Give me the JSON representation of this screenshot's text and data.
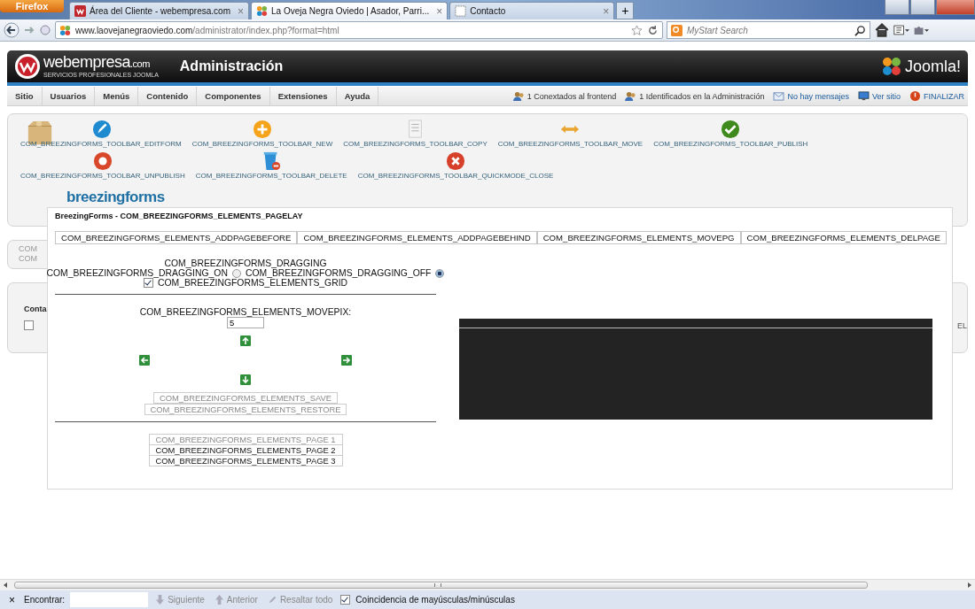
{
  "browser": {
    "app_button": "Firefox",
    "tabs": [
      {
        "title": "Área del Cliente - webempresa.com",
        "close": "×",
        "selected": false
      },
      {
        "title": "La Oveja Negra Oviedo | Asador, Parri...",
        "close": "×",
        "selected": true
      },
      {
        "title": "Contacto",
        "close": "×",
        "selected": false
      }
    ],
    "new_tab": "+",
    "url_host": "www.laovejanegraoviedo.com",
    "url_path": "/administrator/index.php?format=html",
    "search_placeholder": "MyStart Search"
  },
  "header": {
    "brand": "webempresa",
    "brand_suffix": ".com",
    "brand_tagline": "SERVICIOS PROFESIONALES JOOMLA",
    "title": "Administración",
    "cms_logo": "Joomla!"
  },
  "menu": [
    "Sitio",
    "Usuarios",
    "Menús",
    "Contenido",
    "Componentes",
    "Extensiones",
    "Ayuda"
  ],
  "status": [
    {
      "kind": "users",
      "text": "1 Conextados al frontend"
    },
    {
      "kind": "users",
      "text": "1 Identificados en la Administración"
    },
    {
      "kind": "mail",
      "text": "No hay mensajes"
    },
    {
      "kind": "view",
      "text": "Ver sitio"
    },
    {
      "kind": "logout",
      "text": "FINALIZAR"
    }
  ],
  "toolbar": [
    [
      "COM_BREEZINGFORMS_TOOLBAR_EDITFORM",
      "COM_BREEZINGFORMS_TOOLBAR_NEW",
      "COM_BREEZINGFORMS_TOOLBAR_COPY",
      "COM_BREEZINGFORMS_TOOLBAR_MOVE",
      "COM_BREEZINGFORMS_TOOLBAR_PUBLISH"
    ],
    [
      "COM_BREEZINGFORMS_TOOLBAR_UNPUBLISH",
      "COM_BREEZINGFORMS_TOOLBAR_DELETE",
      "COM_BREEZINGFORMS_TOOLBAR_QUICKMODE_CLOSE"
    ]
  ],
  "background": {
    "logo": "breezingforms",
    "stubs": [
      "COM",
      "COM"
    ],
    "section": "Conta",
    "right_stub": "EL",
    "row_checked": false
  },
  "modal": {
    "title": "BreezingForms - COM_BREEZINGFORMS_ELEMENTS_PAGELAY",
    "page_buttons": [
      "COM_BREEZINGFORMS_ELEMENTS_ADDPAGEBEFORE",
      "COM_BREEZINGFORMS_ELEMENTS_ADDPAGEBEHIND",
      "COM_BREEZINGFORMS_ELEMENTS_MOVEPG",
      "COM_BREEZINGFORMS_ELEMENTS_DELPAGE"
    ],
    "dragging_label": "COM_BREEZINGFORMS_DRAGGING",
    "drag_options": [
      {
        "label": "COM_BREEZINGFORMS_DRAGGING_ON",
        "selected": false
      },
      {
        "label": "COM_BREEZINGFORMS_DRAGGING_OFF",
        "selected": true
      }
    ],
    "grid": {
      "label": "COM_BREEZINGFORMS_ELEMENTS_GRID",
      "checked": true
    },
    "movepix_label": "COM_BREEZINGFORMS_ELEMENTS_MOVEPIX:",
    "movepix_value": "5",
    "actions": [
      {
        "label": "COM_BREEZINGFORMS_ELEMENTS_SAVE",
        "disabled": true
      },
      {
        "label": "COM_BREEZINGFORMS_ELEMENTS_RESTORE",
        "disabled": true
      }
    ],
    "pages": [
      {
        "label": "COM_BREEZINGFORMS_ELEMENTS_PAGE 1",
        "disabled": true
      },
      {
        "label": "COM_BREEZINGFORMS_ELEMENTS_PAGE 2",
        "disabled": false
      },
      {
        "label": "COM_BREEZINGFORMS_ELEMENTS_PAGE 3",
        "disabled": false
      }
    ]
  },
  "find_bar": {
    "close": "×",
    "label": "Encontrar:",
    "next": "Siguiente",
    "prev": "Anterior",
    "highlight": "Resaltar todo",
    "match_case": {
      "label": "Coincidencia de mayúsculas/minúsculas",
      "checked": true
    }
  }
}
